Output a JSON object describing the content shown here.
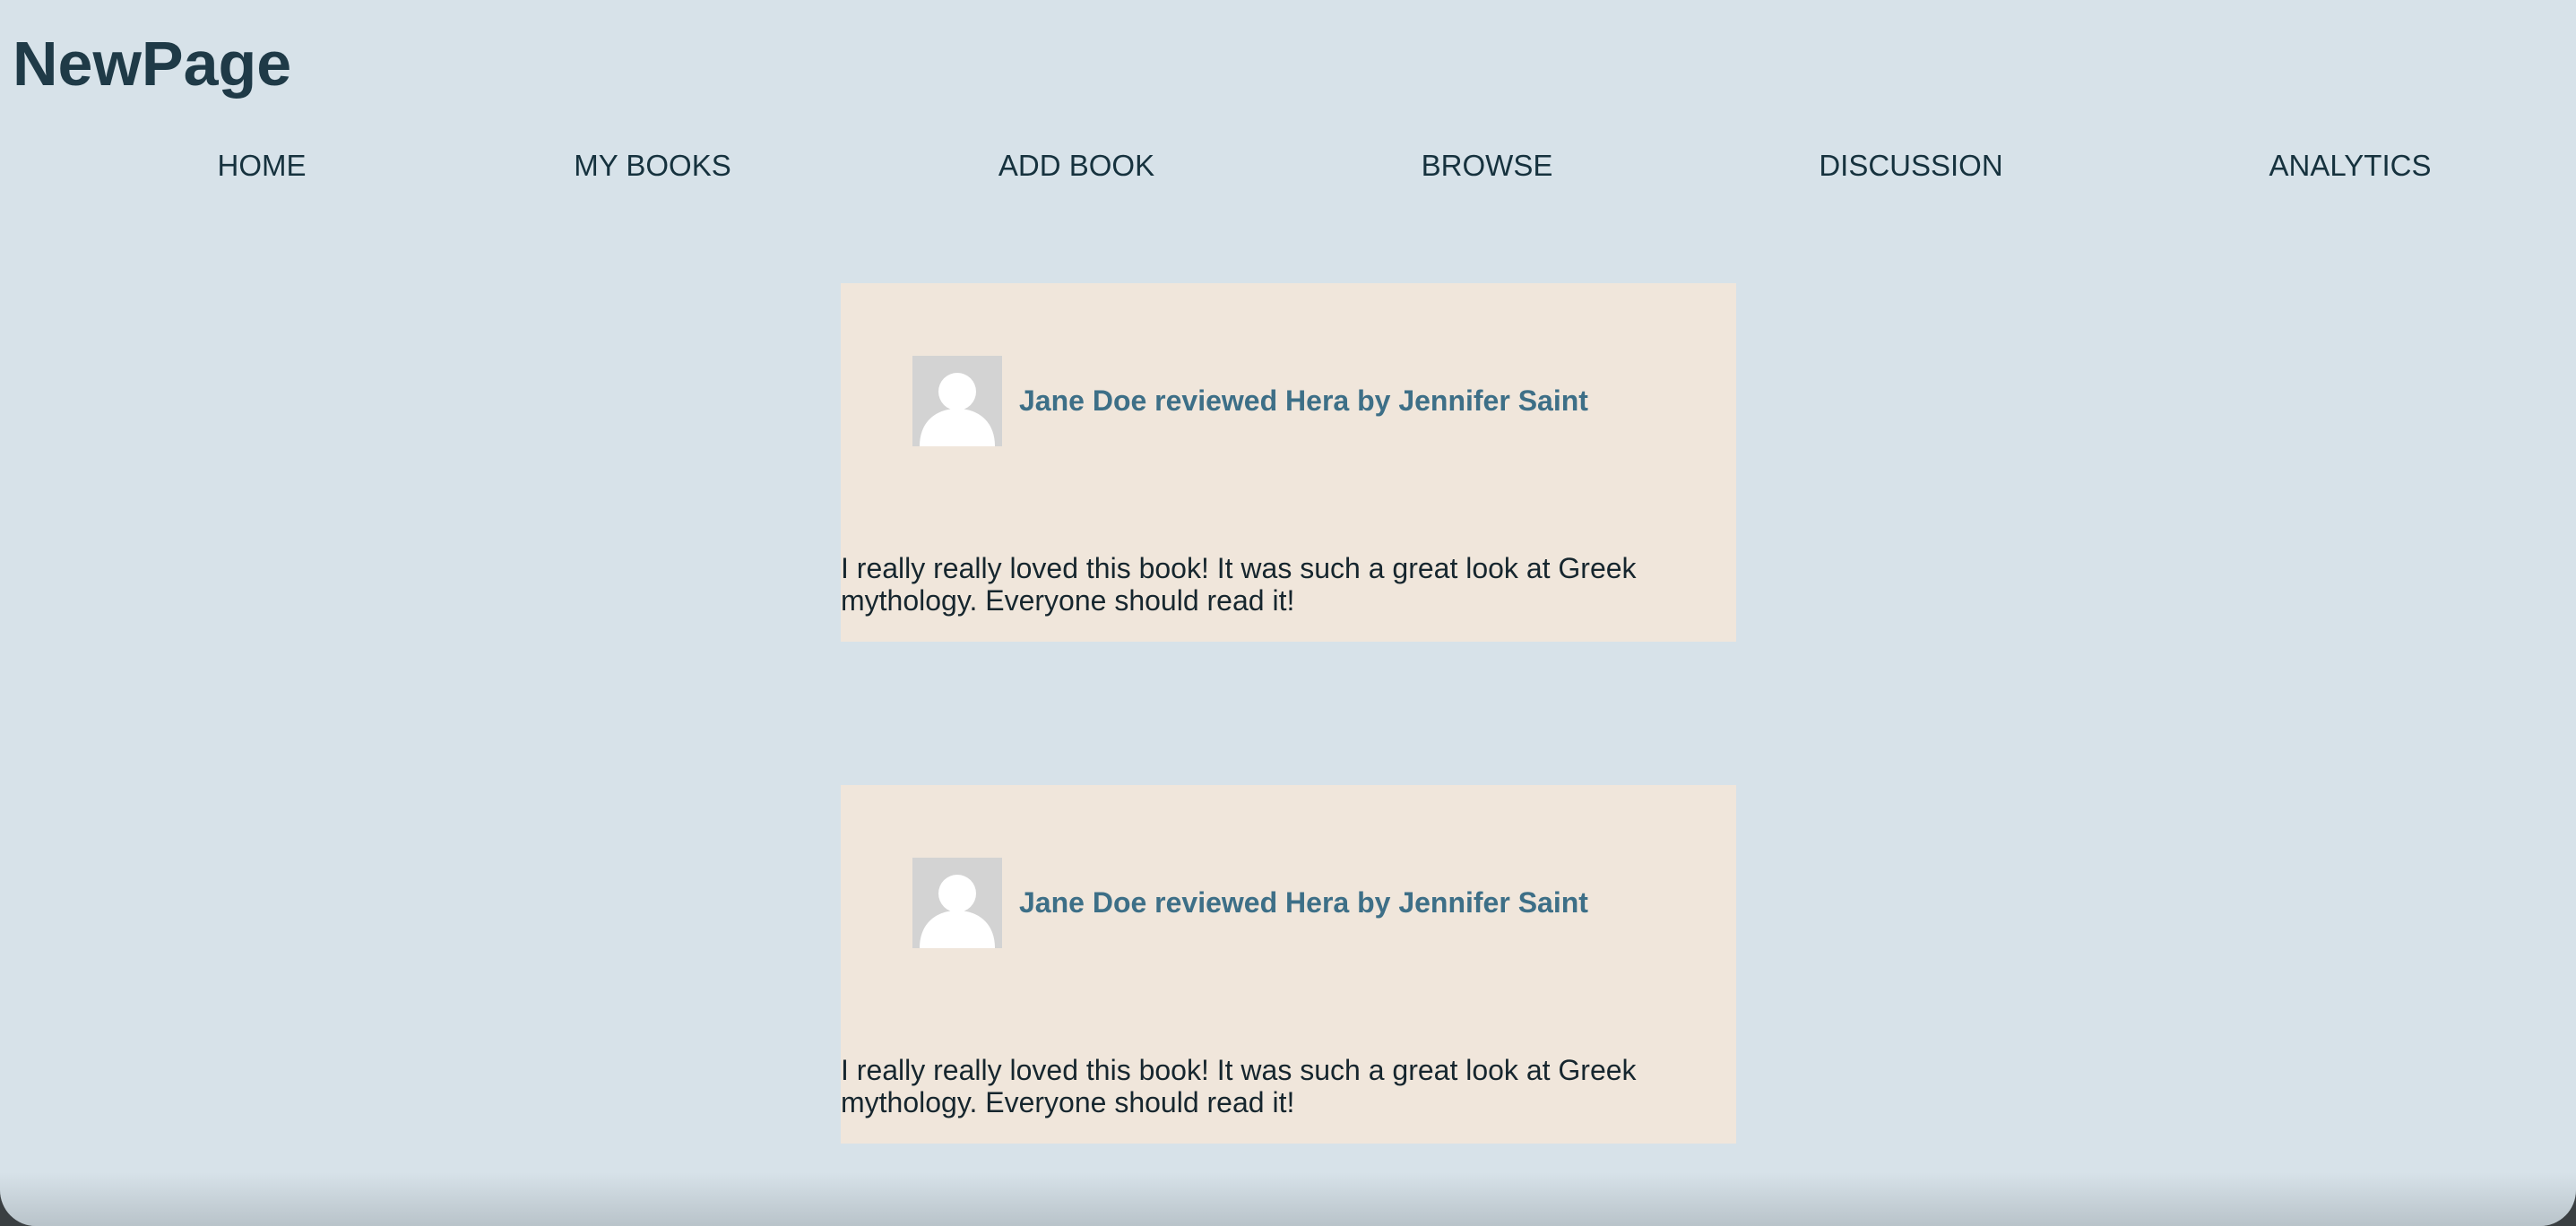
{
  "site": {
    "title": "NewPage"
  },
  "nav": {
    "items": [
      {
        "label": "HOME"
      },
      {
        "label": "MY BOOKS"
      },
      {
        "label": "ADD BOOK"
      },
      {
        "label": "BROWSE"
      },
      {
        "label": "DISCUSSION"
      },
      {
        "label": "ANALYTICS"
      }
    ]
  },
  "reviews": [
    {
      "avatar_icon": "default-user-avatar-icon",
      "heading": "Jane Doe reviewed Hera by Jennifer Saint",
      "body": "I really really loved this book! It was such a great look at Greek mythology. Everyone should read it!"
    },
    {
      "avatar_icon": "default-user-avatar-icon",
      "heading": "Jane Doe reviewed Hera by Jennifer Saint",
      "body": "I really really loved this book! It was such a great look at Greek mythology. Everyone should read it!"
    }
  ],
  "colors": {
    "page_background": "#d7e2e9",
    "card_background": "#f0e6db",
    "title_text": "#1f3a47",
    "review_heading": "#3d6f87",
    "avatar_background": "#d3d3d3"
  }
}
